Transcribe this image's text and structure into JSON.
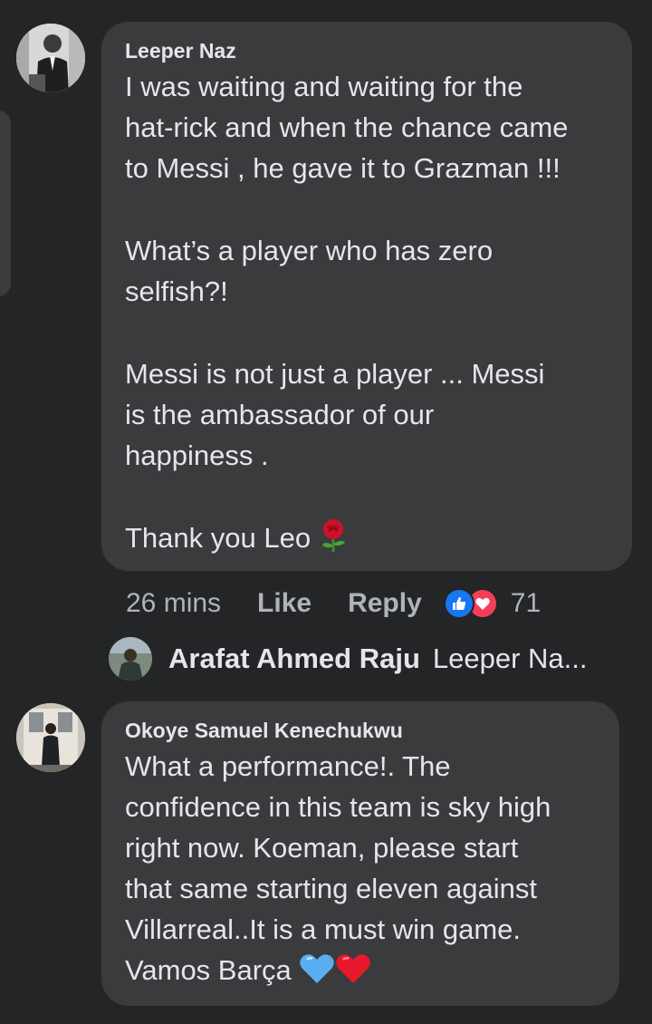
{
  "comments": [
    {
      "author": "Leeper Naz",
      "paragraphs": [
        [
          "I was waiting and waiting for the",
          "hat-rick and when the chance came",
          "to Messi , he gave it to Grazman !!!"
        ],
        [
          "What’s a player who has zero",
          "selfish?!"
        ],
        [
          "Messi is not just a player ... Messi",
          "is the ambassador of our",
          "happiness ."
        ],
        [
          "Thank you Leo"
        ]
      ],
      "emoji": "rose-emoji",
      "time": "26 mins",
      "like_label": "Like",
      "reply_label": "Reply",
      "reactions": [
        "like-icon",
        "love-icon"
      ],
      "reaction_count": "71"
    },
    {
      "author": "Okoye Samuel Kenechukwu",
      "lines": [
        "What a performance!. The",
        "confidence in this team is sky high",
        "right now. Koeman, please start",
        "that same starting eleven against",
        "Villarreal..It is a must win game.",
        "Vamos Barça"
      ],
      "emojis": [
        "light-blue-heart-emoji",
        "red-heart-emoji"
      ]
    }
  ],
  "reply_preview": {
    "name": "Arafat Ahmed Raju",
    "snippet": "Leeper Na..."
  },
  "colors": {
    "background": "#242526",
    "bubble": "#3a3b3c",
    "text": "#e4e6eb",
    "secondary_text": "#b0b3b8",
    "like_blue": "#1877f2",
    "love_red": "#f33e58"
  }
}
